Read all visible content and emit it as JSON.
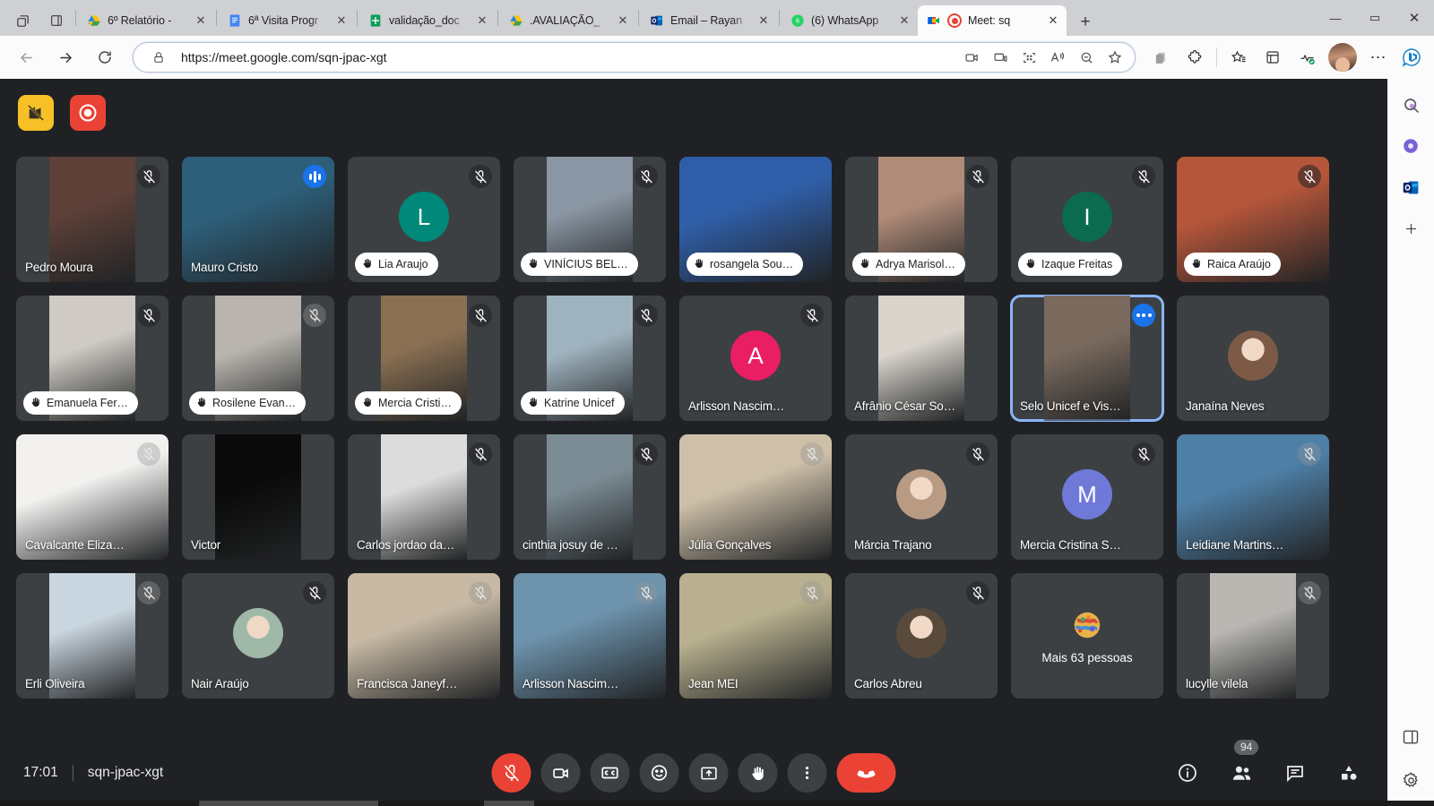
{
  "browser": {
    "tabstrip_buttons": [
      {
        "name": "tab-overview-icon",
        "glyph": "❐"
      },
      {
        "name": "split-screen-icon",
        "glyph": "▯"
      }
    ],
    "tabs": [
      {
        "title": "6º Relatório -",
        "favicon": "google-drive-icon",
        "active": false
      },
      {
        "title": "6ª Visita Progr",
        "favicon": "google-docs-icon",
        "active": false
      },
      {
        "title": "validação_doc",
        "favicon": "google-sheets-icon",
        "active": false
      },
      {
        "title": ".AVALIAÇÃO_",
        "favicon": "google-drive-icon",
        "active": false
      },
      {
        "title": "Email – Rayan",
        "favicon": "outlook-icon",
        "active": false
      },
      {
        "title": "(6) WhatsApp",
        "favicon": "whatsapp-icon",
        "active": false
      },
      {
        "title": "Meet: sq",
        "favicon": "google-meet-icon",
        "active": true,
        "recording": true
      }
    ],
    "new_tab_label": "+",
    "window_controls": [
      "minimize",
      "maximize",
      "close"
    ],
    "nav": {
      "back": "back-arrow-icon",
      "forward": "forward-arrow-icon",
      "reload": "reload-icon"
    },
    "omnibox": {
      "lock": "lock-icon",
      "url_scheme": "https://",
      "url_host": "meet.google.com",
      "url_path": "/sqn-jpac-xgt",
      "url_full": "https://meet.google.com/sqn-jpac-xgt",
      "icons": [
        "camera-icon",
        "cast-icon",
        "qr-code-icon",
        "read-aloud-icon",
        "zoom-out-icon",
        "favorite-star-icon"
      ]
    },
    "toolbar_right": [
      "collections-icon",
      "extensions-icon",
      "favorites-icon",
      "collections-2-icon",
      "browser-essentials-icon",
      "profile-avatar",
      "settings-more-icon",
      "bing-copilot-icon"
    ]
  },
  "edge_sidebar": {
    "items": [
      {
        "name": "sidebar-search-icon",
        "label": "Search"
      },
      {
        "name": "sidebar-copilot-icon",
        "label": "Copilot"
      },
      {
        "name": "sidebar-outlook-icon",
        "label": "Outlook"
      },
      {
        "name": "sidebar-add-icon",
        "label": "+"
      }
    ],
    "bottom_items": [
      {
        "name": "sidebar-split-icon",
        "label": "Split screen"
      },
      {
        "name": "sidebar-settings-icon",
        "label": "Settings"
      }
    ]
  },
  "meet": {
    "overlay_buttons": [
      {
        "name": "screen-share-blocked-button",
        "color": "#f6c026"
      },
      {
        "name": "recording-button",
        "color": "#ea4335"
      }
    ],
    "participants": [
      {
        "name": "Pedro Moura",
        "style": "video",
        "mic": "muted",
        "hand": false,
        "wide": false,
        "tone": "#5d4038"
      },
      {
        "name": "Mauro Cristo",
        "style": "video",
        "mic": "speaking",
        "hand": false,
        "wide": true,
        "tone": "#2d5f7a"
      },
      {
        "name": "Lia Araujo",
        "style": "initial",
        "mic": "muted",
        "hand": true,
        "initial": "L",
        "color": "#00897b"
      },
      {
        "name": "VINÍCIUS BEL…",
        "style": "video",
        "mic": "muted",
        "hand": true,
        "wide": false,
        "tone": "#8a96a3"
      },
      {
        "name": "rosangela Sou…",
        "style": "video",
        "mic": "none",
        "hand": true,
        "wide": true,
        "tone": "#2f5ea8"
      },
      {
        "name": "Adrya Marisol…",
        "style": "video",
        "mic": "muted",
        "hand": true,
        "wide": false,
        "tone": "#b08b78"
      },
      {
        "name": "Izaque Freitas",
        "style": "initial",
        "mic": "muted",
        "hand": true,
        "initial": "I",
        "color": "#0b6b4f"
      },
      {
        "name": "Raica Araújo",
        "style": "video",
        "mic": "muted",
        "hand": true,
        "wide": true,
        "tone": "#b5563a"
      },
      {
        "name": "Emanuela Fer…",
        "style": "video",
        "mic": "muted",
        "hand": true,
        "wide": false,
        "tone": "#cfcbc4"
      },
      {
        "name": "Rosilene Evan…",
        "style": "video",
        "mic": "muted-dim",
        "hand": true,
        "wide": false,
        "tone": "#b9b5ae"
      },
      {
        "name": "Mercia Cristi…",
        "style": "video",
        "mic": "muted",
        "hand": true,
        "wide": false,
        "tone": "#8a6f52"
      },
      {
        "name": "Katrine Unicef",
        "style": "video",
        "mic": "muted",
        "hand": true,
        "wide": false,
        "tone": "#9fb3bf"
      },
      {
        "name": "Arlisson Nascim…",
        "style": "initial",
        "mic": "muted",
        "hand": false,
        "initial": "A",
        "color": "#e91e63"
      },
      {
        "name": "Afrânio César So…",
        "style": "video",
        "mic": "none",
        "hand": false,
        "wide": false,
        "tone": "#d9d4cc"
      },
      {
        "name": "Selo Unicef e Vis…",
        "style": "video",
        "mic": "more",
        "hand": false,
        "wide": false,
        "speaking_border": true,
        "tone": "#7a6a5e"
      },
      {
        "name": "Janaína Neves",
        "style": "photo",
        "mic": "none",
        "hand": false,
        "color": "#7d5a46"
      },
      {
        "name": "Cavalcante Eliza…",
        "style": "video",
        "mic": "muted-dim",
        "hand": false,
        "wide": true,
        "tone": "#f2f1ef"
      },
      {
        "name": "Victor",
        "style": "video",
        "mic": "none",
        "hand": false,
        "wide": false,
        "tone": "#0a0a0a"
      },
      {
        "name": "Carlos jordao da…",
        "style": "video",
        "mic": "muted",
        "hand": false,
        "wide": false,
        "tone": "#dcdcdc"
      },
      {
        "name": "cinthia josuy de …",
        "style": "video",
        "mic": "muted",
        "hand": false,
        "wide": false,
        "tone": "#7b8b94"
      },
      {
        "name": "Júlia Gonçalves",
        "style": "video",
        "mic": "muted-dim",
        "hand": false,
        "wide": true,
        "tone": "#cdbfa8"
      },
      {
        "name": "Márcia Trajano",
        "style": "photo",
        "mic": "muted",
        "hand": false,
        "color": "#b99a82"
      },
      {
        "name": "Mercia Cristina S…",
        "style": "initial",
        "mic": "muted",
        "hand": false,
        "initial": "M",
        "color": "#6f79d8"
      },
      {
        "name": "Leidiane Martins…",
        "style": "video",
        "mic": "muted-dim",
        "hand": false,
        "wide": true,
        "tone": "#4e7fa6"
      },
      {
        "name": "Erli Oliveira",
        "style": "video",
        "mic": "muted-dim",
        "hand": false,
        "wide": false,
        "tone": "#c9d6e0"
      },
      {
        "name": "Nair Araújo",
        "style": "photo",
        "mic": "muted",
        "hand": false,
        "color": "#9fb8a8"
      },
      {
        "name": "Francisca Janeyf…",
        "style": "video",
        "mic": "muted-dim",
        "hand": false,
        "wide": true,
        "tone": "#c7b9a4"
      },
      {
        "name": "Arlisson Nascim…",
        "style": "video",
        "mic": "muted-dim",
        "hand": false,
        "wide": true,
        "tone": "#6d93ad"
      },
      {
        "name": "Jean MEI",
        "style": "video",
        "mic": "muted-dim",
        "hand": false,
        "wide": true,
        "tone": "#b8b08e"
      },
      {
        "name": "Carlos Abreu",
        "style": "photo",
        "mic": "muted",
        "hand": false,
        "color": "#5a4a3c"
      },
      {
        "name": "Mais 63 pessoas",
        "style": "overflow",
        "mic": "none",
        "hand": false
      },
      {
        "name": "lucylle vilela",
        "style": "video",
        "mic": "muted-dim",
        "hand": false,
        "wide": false,
        "tone": "#b9b7b2"
      }
    ],
    "bottom_bar": {
      "time": "17:01",
      "meeting_code": "sqn-jpac-xgt",
      "controls": [
        {
          "name": "microphone-button",
          "label": "Desativar microfone",
          "icon": "mic-off-icon",
          "state": "danger"
        },
        {
          "name": "camera-button",
          "label": "Desativar câmera",
          "icon": "video-icon",
          "state": "normal"
        },
        {
          "name": "captions-button",
          "label": "Ativar legendas",
          "icon": "cc-icon",
          "state": "normal"
        },
        {
          "name": "reactions-button",
          "label": "Reações",
          "icon": "emoji-icon",
          "state": "normal"
        },
        {
          "name": "present-button",
          "label": "Apresentar agora",
          "icon": "present-icon",
          "state": "normal"
        },
        {
          "name": "raise-hand-button",
          "label": "Levantar a mão",
          "icon": "hand-icon",
          "state": "normal"
        },
        {
          "name": "more-options-button",
          "label": "Mais opções",
          "icon": "kebab-icon",
          "state": "normal"
        },
        {
          "name": "leave-call-button",
          "label": "Sair da chamada",
          "icon": "hangup-icon",
          "state": "hangup"
        }
      ],
      "right_controls": [
        {
          "name": "meeting-details-button",
          "label": "Detalhes da reunião",
          "icon": "info-icon",
          "badge": ""
        },
        {
          "name": "participants-button",
          "label": "Mostrar todos",
          "icon": "people-icon",
          "badge": "94"
        },
        {
          "name": "chat-button",
          "label": "Chat da reunião",
          "icon": "chat-icon",
          "badge": ""
        },
        {
          "name": "activities-button",
          "label": "Atividades",
          "icon": "activities-icon",
          "badge": ""
        }
      ]
    }
  },
  "colors": {
    "meet_bg": "#202124",
    "tile_bg": "#3c4043",
    "accent_blue": "#8ab4f8",
    "danger_red": "#ea4335",
    "speak_blue": "#1a73e8",
    "record_yellow": "#f6c026"
  }
}
